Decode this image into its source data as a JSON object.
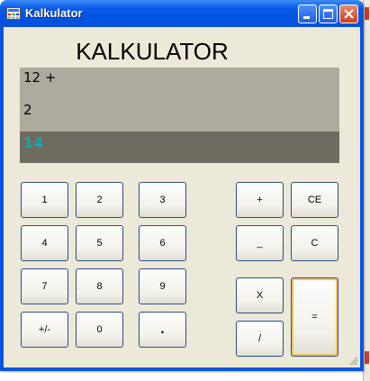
{
  "window": {
    "title": "Kalkulator"
  },
  "app": {
    "heading": "KALKULATOR"
  },
  "display": {
    "expression": "12 +",
    "operand": "2",
    "result": "14",
    "result_color": "#1aa8a8"
  },
  "buttons": {
    "one": "1",
    "two": "2",
    "three": "3",
    "four": "4",
    "five": "5",
    "six": "6",
    "seven": "7",
    "eight": "8",
    "nine": "9",
    "sign": "+/-",
    "zero": "0",
    "dot": ".",
    "plus": "+",
    "ce": "CE",
    "minus": "_",
    "clear": "C",
    "multiply": "X",
    "equals": "=",
    "divide": "/"
  },
  "icons": {
    "app": "calculator-app-icon",
    "minimize": "minimize-icon",
    "maximize": "maximize-icon",
    "close": "close-icon",
    "grip": "resize-grip-icon"
  }
}
